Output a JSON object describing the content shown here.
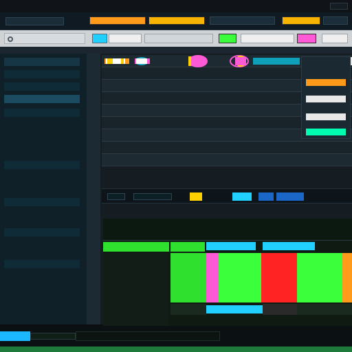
{
  "window": {
    "title": "",
    "accent": "#24c7ff"
  },
  "menubar": {
    "items": [
      "",
      "",
      "",
      "",
      "",
      ""
    ]
  },
  "toolbar": {
    "search_placeholder": "",
    "buttons": [
      "",
      "",
      "",
      "",
      ""
    ]
  },
  "sidebar": {
    "items": [
      "",
      "",
      "",
      "",
      "",
      "",
      "",
      "",
      ""
    ]
  },
  "main": {
    "rows": [
      {
        "col1": "",
        "col2": "",
        "col3": "",
        "col4": ""
      },
      {
        "col1": "",
        "col2": "",
        "col3": "",
        "col4": ""
      },
      {
        "col1": "",
        "col2": "",
        "col3": "",
        "col4": ""
      },
      {
        "col1": "",
        "col2": "",
        "col3": "",
        "col4": ""
      },
      {
        "col1": "",
        "col2": "",
        "col3": "",
        "col4": ""
      },
      {
        "col1": "",
        "col2": "",
        "col3": "",
        "col4": ""
      },
      {
        "col1": "",
        "col2": "",
        "col3": "",
        "col4": ""
      },
      {
        "col1": "",
        "col2": "",
        "col3": "",
        "col4": ""
      },
      {
        "col1": "",
        "col2": "",
        "col3": "",
        "col4": ""
      }
    ],
    "side_panel": {
      "header": "",
      "items": [
        "",
        "",
        "",
        ""
      ]
    }
  },
  "lower": {
    "header": {
      "tab1": "",
      "tab2": "",
      "tab3": "",
      "tab4": ""
    },
    "cells": [
      [
        "",
        "",
        "",
        ""
      ],
      [
        "",
        "",
        "",
        ""
      ],
      [
        "",
        "",
        "",
        ""
      ],
      [
        "",
        "",
        "",
        ""
      ],
      [
        "",
        "",
        "",
        ""
      ]
    ]
  },
  "status": {
    "left": "",
    "right": ""
  },
  "colors": {
    "green": "#2fe02f",
    "bright_green": "#3aff3a",
    "magenta": "#ff5ad6",
    "red": "#ff2323",
    "orange": "#ff9a1a",
    "cyan": "#21d0ff"
  }
}
